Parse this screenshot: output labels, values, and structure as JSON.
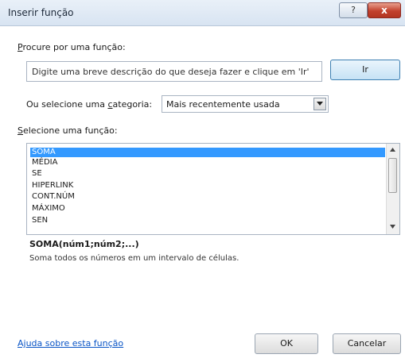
{
  "window": {
    "title": "Inserir função",
    "help_label": "?",
    "close_label": "x"
  },
  "search": {
    "label_first": "P",
    "label_rest": "rocure por uma função:",
    "value": "Digite uma breve descrição do que deseja fazer e clique em 'Ir'",
    "go_label": "Ir"
  },
  "category": {
    "label_pre": "Ou selecione uma ",
    "label_accel": "c",
    "label_post": "ategoria:",
    "selected": "Mais recentemente usada"
  },
  "functions": {
    "label_first": "S",
    "label_rest": "elecione uma função:",
    "items": [
      "SOMA",
      "MÉDIA",
      "SE",
      "HIPERLINK",
      "CONT.NÚM",
      "MÁXIMO",
      "SEN"
    ],
    "selected_index": 0,
    "signature": "SOMA(núm1;núm2;...)",
    "description": "Soma todos os números em um intervalo de células."
  },
  "footer": {
    "help_link": "Ajuda sobre esta função",
    "ok_label": "OK",
    "cancel_label": "Cancelar"
  },
  "icons": [
    "help-icon",
    "close-icon",
    "chevron-down-icon",
    "scroll-up-icon",
    "scroll-down-icon"
  ],
  "colors": {
    "selection": "#3399ff",
    "link": "#0a55c6",
    "close": "#c2412d"
  }
}
